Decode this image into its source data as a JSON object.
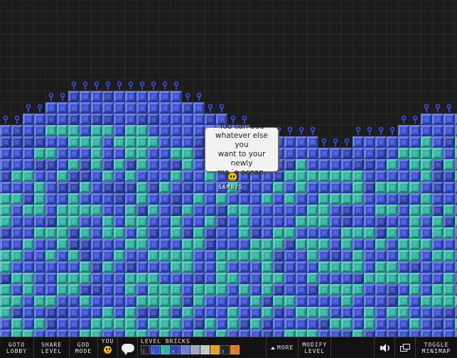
{
  "world": {
    "colors": {
      "background": "#1c1c1c",
      "blue_block": "#3a50d0",
      "teal_block": "#2fb3a5",
      "blue_small_block": "#3144b6",
      "key_color": "#3a4fe8"
    }
  },
  "chat_bubble": {
    "line1": "You can add",
    "line2": "whatever else you",
    "line3": "want to your newly",
    "line4": "made ocean."
  },
  "player": {
    "name": "SAM875",
    "icon": "smiley-face-icon"
  },
  "toolbar": {
    "goto_lobby": [
      "GOTO",
      "LOBBY"
    ],
    "share_level": [
      "SHARE",
      "LEVEL"
    ],
    "god_mode": [
      "GOD",
      "MODE"
    ],
    "you_label": "YOU",
    "chat_icon": "speech-bubble-icon",
    "level_bricks_label": "LEVEL BRICKS",
    "more_label": "MORE",
    "modify_level": [
      "MODIFY",
      "LEVEL"
    ],
    "sound_icon": "speaker-icon",
    "window_icon": "window-toggle-icon",
    "toggle_minimap": [
      "TOGGLE",
      "MINIMAP"
    ],
    "bricks": [
      {
        "key": "1",
        "color": "#222"
      },
      {
        "key": "2",
        "color": "#3a50d0"
      },
      {
        "key": "3",
        "color": "#2fb3a5"
      },
      {
        "key": "4",
        "color": "#3144b6"
      },
      {
        "key": "5",
        "color": "#6c7ad8"
      },
      {
        "key": "6",
        "color": "#a0a6c8"
      },
      {
        "key": "7",
        "color": "#c9c9c9"
      },
      {
        "key": "8",
        "color": "#e0a020"
      },
      {
        "key": "9",
        "color": "#222"
      },
      {
        "key": "0",
        "color": "#e07a20"
      }
    ]
  }
}
